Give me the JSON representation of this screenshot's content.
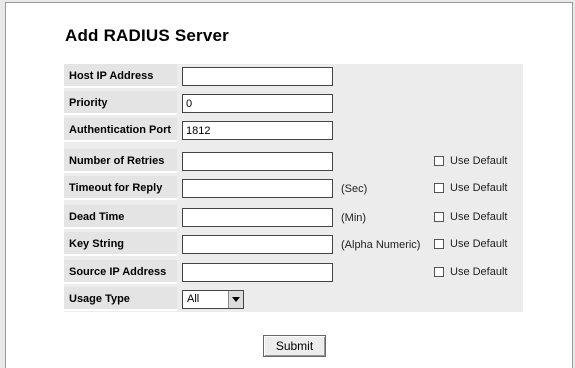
{
  "title": "Add RADIUS Server",
  "fields": [
    {
      "label": "Host IP Address",
      "value": "",
      "unit": "",
      "use_default": ""
    },
    {
      "label": "Priority",
      "value": "0",
      "unit": "",
      "use_default": ""
    },
    {
      "label": "Authentication Port",
      "value": "1812",
      "unit": "",
      "use_default": ""
    },
    {
      "label": "Number of Retries",
      "value": "",
      "unit": "",
      "use_default": "Use Default"
    },
    {
      "label": "Timeout for Reply",
      "value": "",
      "unit": "(Sec)",
      "use_default": "Use Default"
    },
    {
      "label": "Dead Time",
      "value": "",
      "unit": "(Min)",
      "use_default": "Use Default"
    },
    {
      "label": "Key String",
      "value": "",
      "unit": "(Alpha Numeric)",
      "use_default": "Use Default"
    },
    {
      "label": "Source IP Address",
      "value": "",
      "unit": "",
      "use_default": "Use Default"
    }
  ],
  "usage_type": {
    "label": "Usage Type",
    "selected": "All"
  },
  "submit_label": "Submit"
}
